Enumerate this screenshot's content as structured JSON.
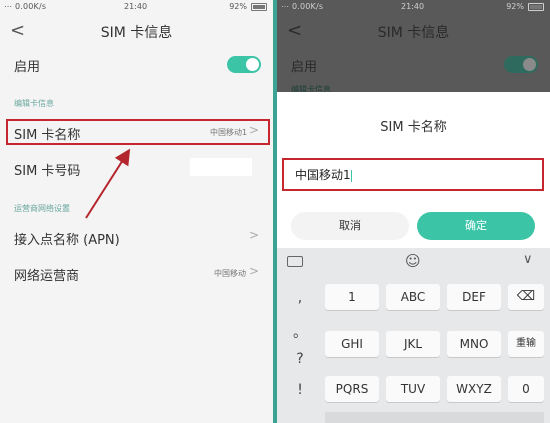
{
  "status": {
    "signal": "⋯ 0.00K/s",
    "time": "21:40",
    "battery": "92%"
  },
  "left": {
    "title": "SIM 卡信息",
    "enable_label": "启用",
    "section_edit": "编辑卡信息",
    "sim_name_label": "SIM 卡名称",
    "sim_name_value": "中国移动1",
    "sim_number_label": "SIM 卡号码",
    "section_operator": "运营商网络设置",
    "apn_label": "接入点名称 (APN)",
    "operator_label": "网络运营商",
    "operator_value": "中国移动"
  },
  "right": {
    "title": "SIM 卡信息",
    "enable_label": "启用",
    "section_edit": "编辑卡信息",
    "dialog_title": "SIM 卡名称",
    "input_value": "中国移动1",
    "cancel_label": "取消",
    "confirm_label": "确定"
  },
  "keyboard": {
    "side_keys": [
      ",",
      "。",
      "?",
      "!"
    ],
    "rows": [
      [
        "1",
        "ABC",
        "DEF"
      ],
      [
        "GHI",
        "JKL",
        "MNO"
      ],
      [
        "PQRS",
        "TUV",
        "WXYZ"
      ]
    ],
    "backspace": "⌫",
    "reinput": "重输",
    "zero": "0"
  },
  "colors": {
    "accent": "#3cc4a7",
    "highlight": "#c6262e",
    "divider": "#3aa394"
  }
}
